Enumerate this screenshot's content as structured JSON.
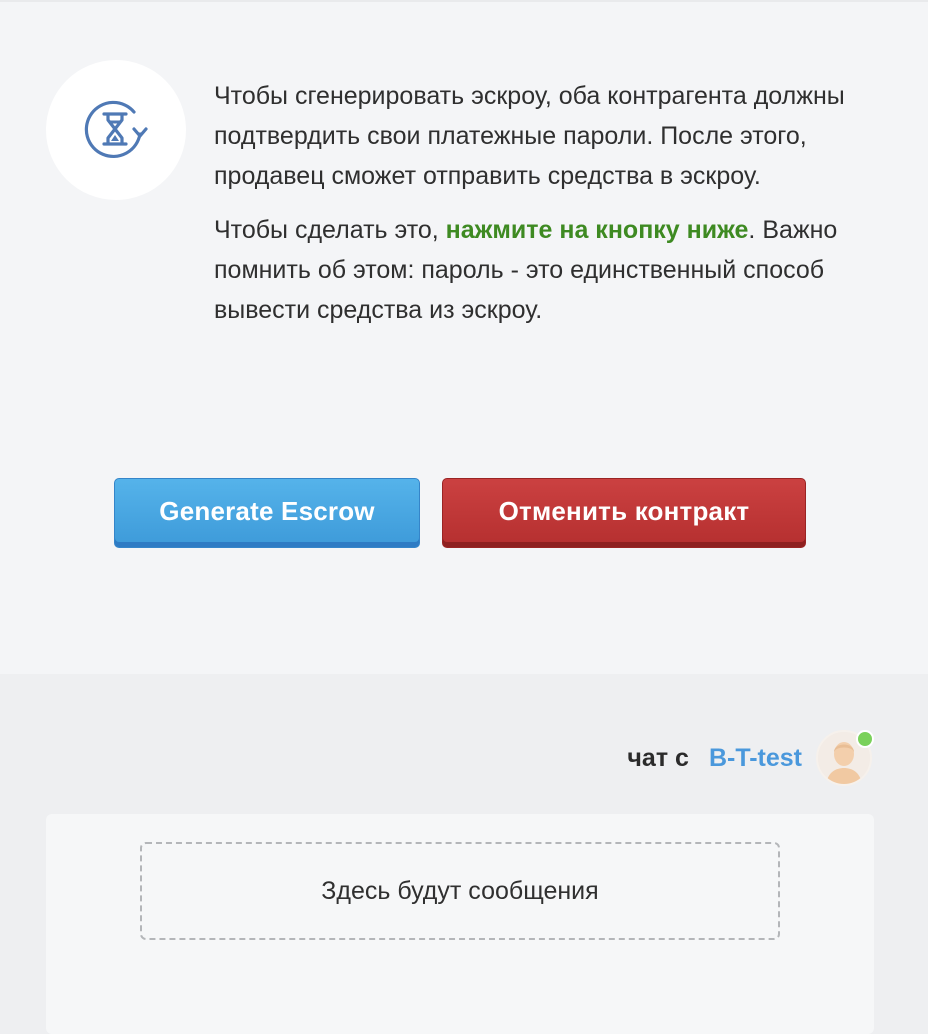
{
  "escrow_info": {
    "icon": "hourglass-refresh-icon",
    "paragraph1": "Чтобы сгенерировать эскроу, оба контрагента должны подтвердить свои платежные пароли. После этого, продавец сможет отправить средства в эскроу.",
    "paragraph2_prefix": "Чтобы сделать это, ",
    "paragraph2_highlight": "нажмите на кнопку ниже",
    "paragraph2_suffix": ". Важно помнить об этом: пароль - это единственный способ вывести средства из эскроу."
  },
  "actions": {
    "generate_label": "Generate Escrow",
    "cancel_label": "Отменить контракт"
  },
  "chat": {
    "label": "чат с",
    "user": "B-T-test",
    "avatar_icon": "user-avatar-icon",
    "status": "online",
    "empty_placeholder": "Здесь будут сообщения"
  },
  "colors": {
    "highlight": "#3e8a22",
    "primary_button": "#48a7e2",
    "danger_button": "#c03838",
    "link": "#4a98dc",
    "online": "#7ad15a"
  }
}
